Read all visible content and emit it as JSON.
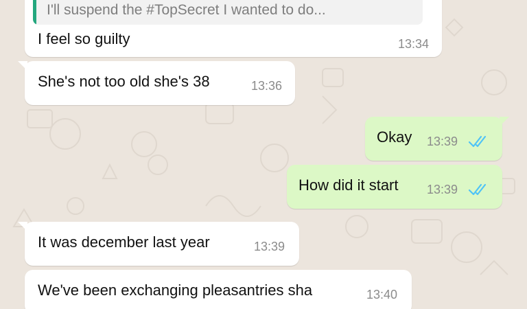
{
  "colors": {
    "wallpaper": "#ECE5DD",
    "incoming_bubble": "#FFFFFF",
    "outgoing_bubble": "#DCF8C6",
    "quote_accent": "#24A77E",
    "read_ticks": "#4FC3F7"
  },
  "messages": [
    {
      "direction": "incoming",
      "quoted_text": "I'll suspend the #TopSecret I wanted to do...",
      "text": "I feel so guilty",
      "time": "13:34"
    },
    {
      "direction": "incoming",
      "text": "She's not too old she's 38",
      "time": "13:36"
    },
    {
      "direction": "outgoing",
      "text": "Okay",
      "time": "13:39",
      "status_icon": "double-check-read-icon"
    },
    {
      "direction": "outgoing",
      "text": "How did it start",
      "time": "13:39",
      "status_icon": "double-check-read-icon"
    },
    {
      "direction": "incoming",
      "text": "It was december last year",
      "time": "13:39"
    },
    {
      "direction": "incoming",
      "text": "We've been exchanging pleasantries sha",
      "time": "13:40"
    }
  ]
}
